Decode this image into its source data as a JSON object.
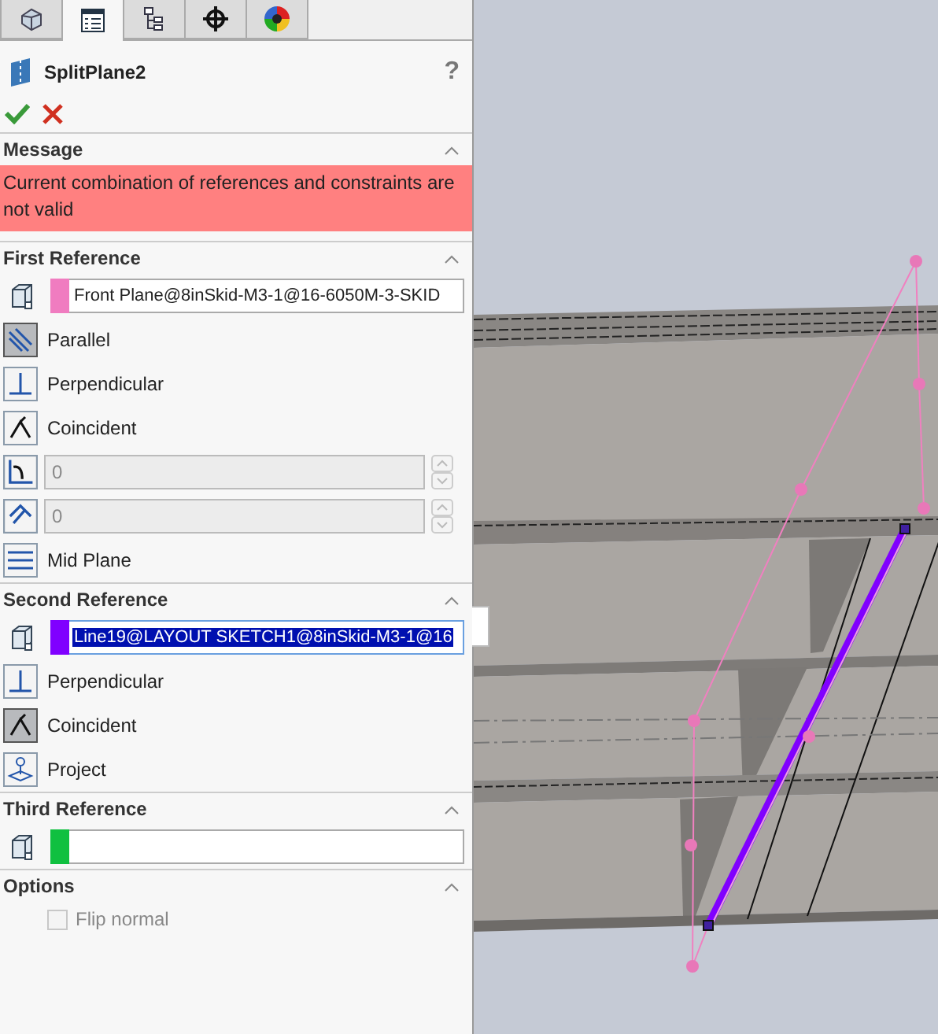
{
  "tabs": [
    {
      "selected": false
    },
    {
      "selected": true
    },
    {
      "selected": false
    },
    {
      "selected": false
    },
    {
      "selected": false
    }
  ],
  "feature": {
    "title": "SplitPlane2",
    "help": "?"
  },
  "message": {
    "heading": "Message",
    "text": "Current combination of references and constraints are not valid"
  },
  "references": [
    {
      "heading": "First Reference",
      "selection": {
        "value": "Front Plane@8inSkid-M3-1@16-6050M-3-SKID",
        "color": "#f07cc0",
        "highlighted": false
      },
      "options": [
        {
          "kind": "parallel",
          "label": "Parallel",
          "selected": true
        },
        {
          "kind": "perpendicular",
          "label": "Perpendicular",
          "selected": false
        },
        {
          "kind": "coincident",
          "label": "Coincident",
          "selected": false
        },
        {
          "kind": "angle",
          "value": "0",
          "disabled": true
        },
        {
          "kind": "distance",
          "value": "0",
          "disabled": true
        },
        {
          "kind": "mid-plane",
          "label": "Mid Plane",
          "selected": false
        }
      ]
    },
    {
      "heading": "Second Reference",
      "selection": {
        "value": "Line19@LAYOUT SKETCH1@8inSkid-M3-1@16",
        "color": "#8000ff",
        "highlighted": true
      },
      "options": [
        {
          "kind": "perpendicular",
          "label": "Perpendicular",
          "selected": false
        },
        {
          "kind": "coincident",
          "label": "Coincident",
          "selected": true
        },
        {
          "kind": "project",
          "label": "Project",
          "selected": false
        }
      ]
    },
    {
      "heading": "Third Reference",
      "selection": {
        "color": "#10c040",
        "highlighted": false
      }
    }
  ],
  "options": {
    "heading": "Options",
    "flip_normal": {
      "label": "Flip normal",
      "checked": false,
      "disabled": true
    }
  }
}
